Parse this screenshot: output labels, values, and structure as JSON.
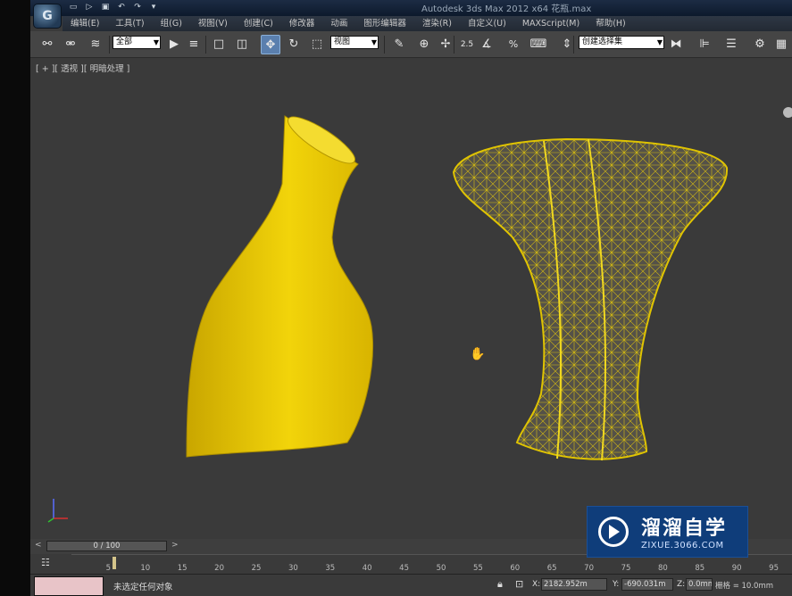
{
  "title_bar": {
    "window_title": "Autodesk 3ds Max  2012 x64     花瓶.max",
    "logo_glyph": "G",
    "quick_access": [
      {
        "icon": "new-icon",
        "glyph": "▭"
      },
      {
        "icon": "open-icon",
        "glyph": "▷"
      },
      {
        "icon": "save-icon",
        "glyph": "▣"
      },
      {
        "icon": "undo-icon",
        "glyph": "↶"
      },
      {
        "icon": "redo-icon",
        "glyph": "↷"
      },
      {
        "icon": "dropdown-icon",
        "glyph": "▾"
      }
    ]
  },
  "menu": {
    "items": [
      "编辑(E)",
      "工具(T)",
      "组(G)",
      "视图(V)",
      "创建(C)",
      "修改器",
      "动画",
      "图形编辑器",
      "渲染(R)",
      "自定义(U)",
      "MAXScript(M)",
      "帮助(H)"
    ]
  },
  "toolbar": {
    "selection_filter": "全部",
    "reference_coord": "视图",
    "named_selection": "创建选择集",
    "snap_label": "2.5",
    "percent_snap_label": "%",
    "buttons": [
      {
        "icon": "link-icon",
        "glyph": "⚯"
      },
      {
        "icon": "unlink-icon",
        "glyph": "⚮"
      },
      {
        "icon": "bind-spacewarp-icon",
        "glyph": "≋"
      },
      {
        "icon": "select-object-icon",
        "glyph": "▶"
      },
      {
        "icon": "select-by-name-icon",
        "glyph": "≡"
      },
      {
        "icon": "rect-region-icon",
        "glyph": "□"
      },
      {
        "icon": "window-crossing-icon",
        "glyph": "◫"
      },
      {
        "icon": "select-move-icon",
        "glyph": "✥"
      },
      {
        "icon": "select-rotate-icon",
        "glyph": "↻"
      },
      {
        "icon": "select-scale-icon",
        "glyph": "⬚"
      },
      {
        "icon": "pivot-icon",
        "glyph": "⊕"
      },
      {
        "icon": "manipulate-icon",
        "glyph": "✢"
      },
      {
        "icon": "keyboard-shortcut-icon",
        "glyph": "⌨"
      },
      {
        "icon": "angle-snap-icon",
        "glyph": "∡"
      },
      {
        "icon": "spinner-snap-icon",
        "glyph": "⇕"
      },
      {
        "icon": "edit-named-sel-icon",
        "glyph": "✎"
      },
      {
        "icon": "mirror-icon",
        "glyph": "⧓"
      },
      {
        "icon": "align-icon",
        "glyph": "⊫"
      },
      {
        "icon": "layer-icon",
        "glyph": "☰"
      },
      {
        "icon": "render-setup-icon",
        "glyph": "⚙"
      },
      {
        "icon": "render-frame-icon",
        "glyph": "▦"
      }
    ]
  },
  "viewport": {
    "label": "[ + ][ 透视 ][ 明暗处理 ]",
    "objects": [
      "solid-vase",
      "wireframe-vase"
    ],
    "vase_color": "#e8c800",
    "wire_color": "#d4b800"
  },
  "time_slider": {
    "label": "0 / 100"
  },
  "trackbar": {
    "ticks": [
      "5",
      "10",
      "15",
      "20",
      "25",
      "30",
      "35",
      "40",
      "45",
      "50",
      "55",
      "60",
      "65",
      "70",
      "75",
      "80",
      "85",
      "90",
      "95"
    ]
  },
  "status": {
    "message": "未选定任何对象",
    "x_label": "X:",
    "x_value": "2182.952m",
    "y_label": "Y:",
    "y_value": "-690.031m",
    "z_label": "Z:",
    "z_value": "0.0mm",
    "grid": "栅格 = 10.0mm"
  },
  "watermark": {
    "title": "溜溜自学",
    "url": "ZIXUE.3066.COM"
  }
}
